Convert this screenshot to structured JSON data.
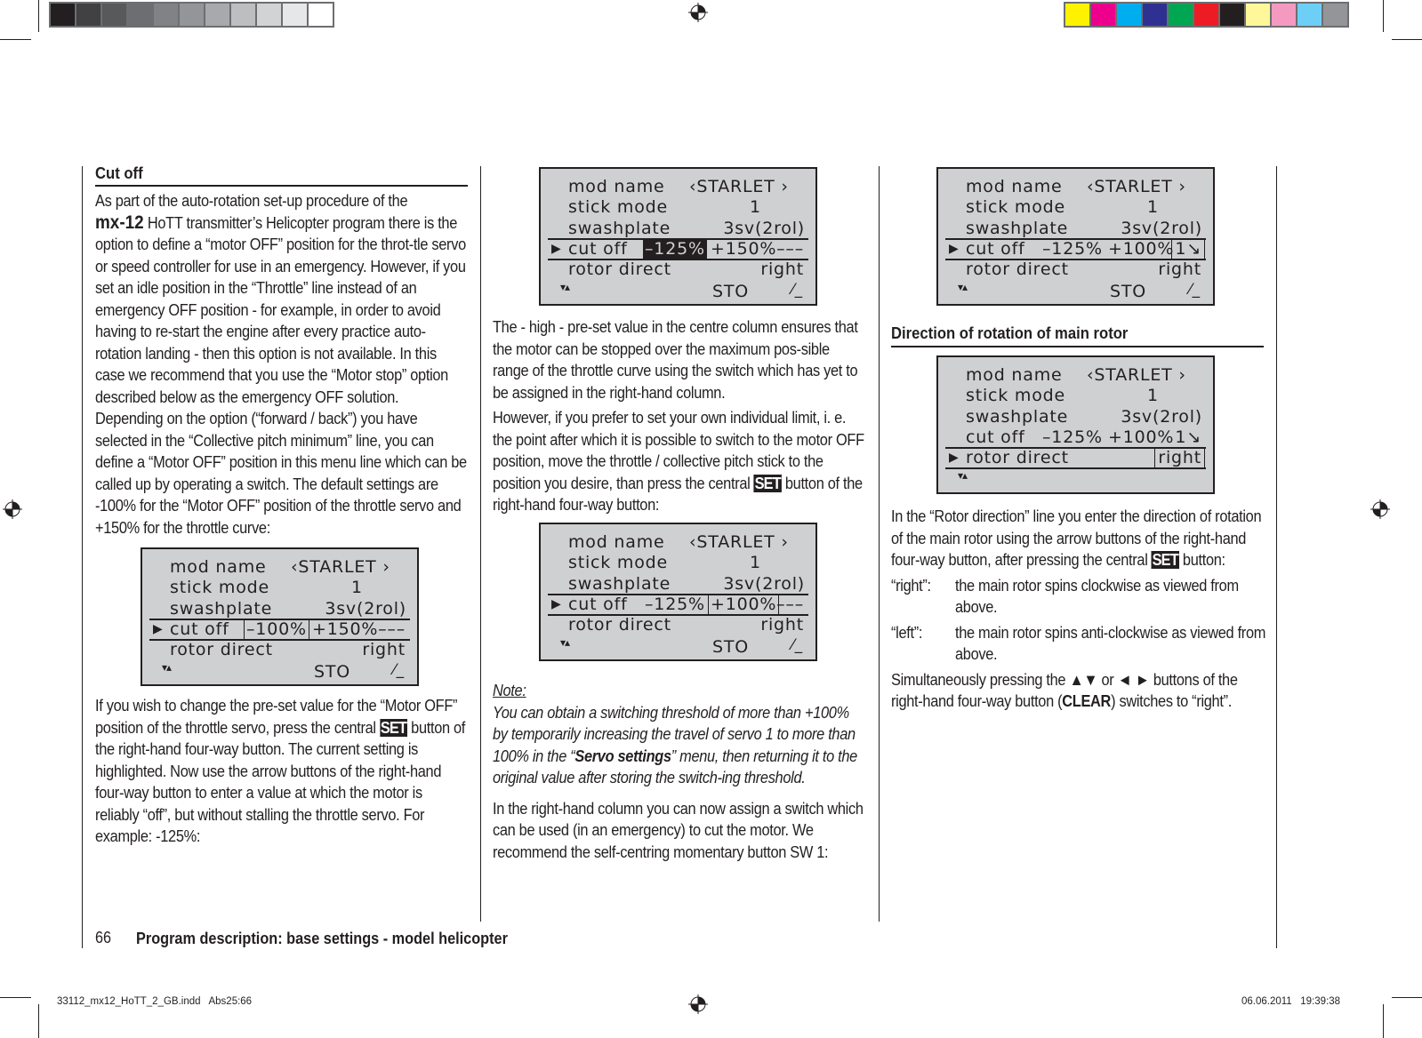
{
  "print_marks": {
    "grayscale_swatches": [
      "#231f20",
      "#414042",
      "#58595b",
      "#6d6e71",
      "#808285",
      "#939598",
      "#a7a9ac",
      "#bcbec0",
      "#d1d3d4",
      "#e6e7e8",
      "#ffffff"
    ],
    "color_swatches": [
      "#fff200",
      "#ec008c",
      "#00aeef",
      "#2e3192",
      "#00a651",
      "#ed1c24",
      "#231f20",
      "#fff799",
      "#f49ac1",
      "#6dcff6",
      "#939598"
    ],
    "slug_left": "33112_mx12_HoTT_2_GB.indd   Abs25:66",
    "slug_right": "06.06.2011   19:39:38"
  },
  "footer": {
    "page_number": "66",
    "section_title": "Program description: base settings - model helicopter"
  },
  "col1": {
    "heading": "Cut off",
    "para1_pre": "As part of the auto-rotation set-up procedure of the",
    "brand": "mx-12",
    "para1_post": " HoTT transmitter’s Helicopter program there is the option to define a “motor OFF” position for the throt-tle servo or speed controller for use in an emergency. However, if you set an idle position in the “Throttle” line instead of an emergency OFF position - for example, in order to avoid having to re-start the engine after every practice auto-rotation landing - then this option is not available. In this case we recommend that you use the “Motor stop” option described below as the emergency OFF solution. Depending on the option (“forward / back”) you have selected in the “Collective pitch minimum” line, you can define a “Motor OFF” position in this menu line which can be called up by operating a switch. The default settings are -100% for the “Motor OFF” position of the throttle servo and +150% for the throttle curve:",
    "para2_pre": "If you wish to change the pre-set value for the “Motor OFF” position of the throttle servo, press the central ",
    "set_label": "SET",
    "para2_post": " button of the right-hand four-way button. The current setting is highlighted. Now use the arrow buttons of the right-hand four-way button to enter a value at which the motor is reliably “off”, but without stalling the throttle servo. For example: -125%:"
  },
  "col2": {
    "para1": "The - high - pre-set value in the centre column ensures that the motor can be stopped over the maximum pos-sible range of the throttle curve using the switch which has yet to be assigned in the right-hand column.",
    "para2_pre": "However, if you prefer to set your own individual limit, i. e. the point after which it is possible to switch to the motor OFF position, move the throttle / collective pitch stick to the position you desire, than press the central ",
    "set_label": "SET",
    "para2_post": " button of the right-hand four-way button:",
    "note_label": "Note:",
    "note_pre": "You can obtain a switching threshold of more than +100% by temporarily increasing the travel of servo 1 to more than 100% in the “",
    "note_bold": "Servo settings",
    "note_post": "” menu, then returning it to the original value after storing the switch-ing threshold.",
    "para3": "In the right-hand column you can now assign a switch which can be used (in an emergency) to cut the motor. We recommend the self-centring momentary button SW 1:"
  },
  "col3": {
    "heading": "Direction of rotation of main rotor",
    "para1_pre": "In the “Rotor direction” line you enter the direction of rotation of the main rotor using the arrow buttons of the right-hand four-way button, after pressing the central ",
    "set_label": "SET",
    "para1_post": " button:",
    "defs": [
      {
        "term": "“right”:",
        "desc": "the main rotor spins clockwise as viewed from above."
      },
      {
        "term": "“left”:",
        "desc": "the main rotor spins anti-clockwise as viewed from above."
      }
    ],
    "para2_pre": "Simultaneously pressing the ▲▼ or ◄ ► buttons of the right-hand four-way button (",
    "clear_label": "CLEAR",
    "para2_post": ") switches to “right”."
  },
  "lcd_common": {
    "mod_name_label": "mod name",
    "mod_name_value": "‹STARLET  ›",
    "stick_mode_label": "stick mode",
    "stick_mode_value": "1",
    "swashplate_label": "swashplate",
    "swashplate_value": "3sv(2rol)",
    "cut_off_label": "cut  off",
    "rotor_direct_label": "rotor direct",
    "rotor_direct_value": "right",
    "sto_label": "STO",
    "pointer": "▶",
    "nav_icon": "▾▴",
    "switch_icon": "⁄_"
  },
  "screens": [
    {
      "id": "default",
      "cut_v1": "–100%",
      "cut_v2": "+150%",
      "cut_sw": "–––",
      "selected_row": "cut_off",
      "highlight": "v1-boxed",
      "show_sto": true
    },
    {
      "id": "edit-125",
      "cut_v1": "–125%",
      "cut_v2": "+150%",
      "cut_sw": "–––",
      "selected_row": "cut_off",
      "highlight": "v1-inverted",
      "show_sto": true
    },
    {
      "id": "threshold-100",
      "cut_v1": "–125%",
      "cut_v2": "+100%",
      "cut_sw": "–––",
      "selected_row": "cut_off",
      "highlight": "v2-boxed",
      "show_sto": true
    },
    {
      "id": "switch-assigned",
      "cut_v1": "–125%",
      "cut_v2": "+100%",
      "cut_sw": "1↘",
      "selected_row": "cut_off",
      "highlight": "sw-boxed",
      "show_sto": true
    },
    {
      "id": "rotor-direction",
      "cut_v1": "–125%",
      "cut_v2": "+100%",
      "cut_sw": "1↘",
      "selected_row": "rotor_direct",
      "highlight": "rotor-boxed",
      "show_sto": false
    }
  ]
}
